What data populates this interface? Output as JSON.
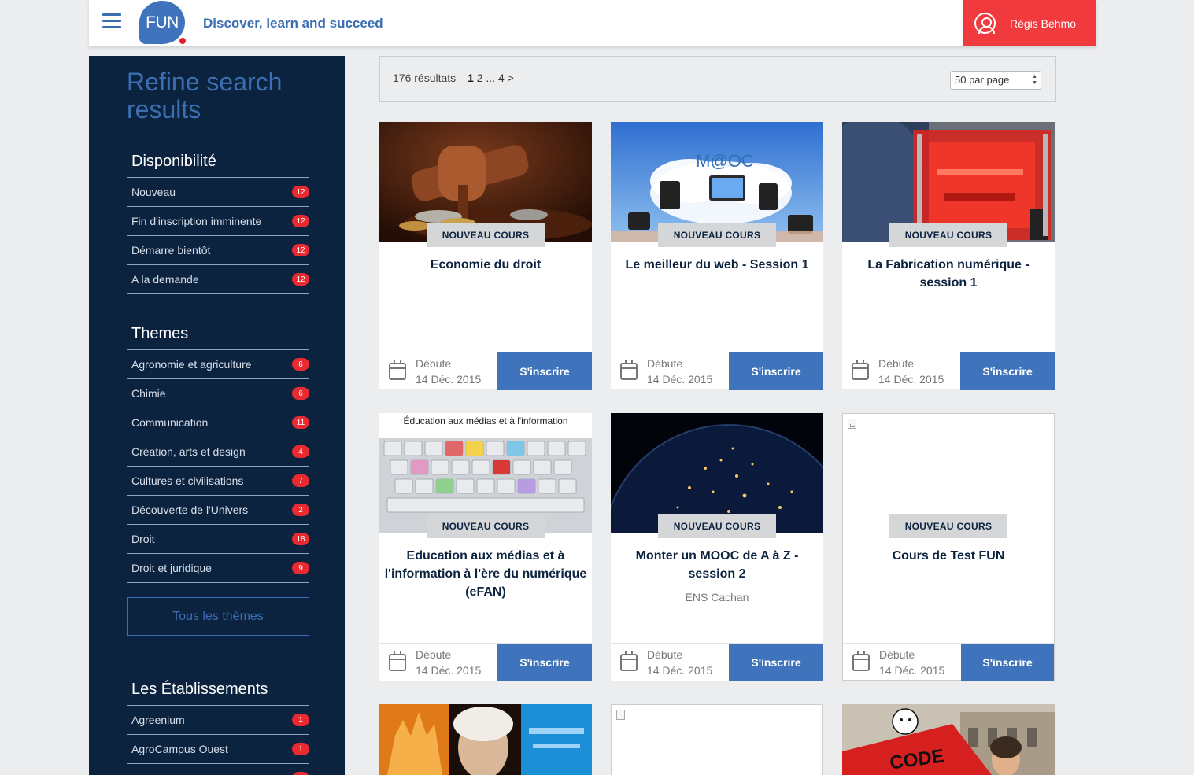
{
  "header": {
    "logo_text": "FUN",
    "tagline": "Discover, learn and succeed",
    "user_name": "Régis Behmo"
  },
  "sidebar": {
    "title": "Refine search results",
    "availability": {
      "heading": "Disponibilité",
      "items": [
        {
          "label": "Nouveau",
          "count": "12"
        },
        {
          "label": "Fin d'inscription imminente",
          "count": "12"
        },
        {
          "label": "Démarre bientôt",
          "count": "12"
        },
        {
          "label": "A la demande",
          "count": "12"
        }
      ]
    },
    "themes": {
      "heading": "Themes",
      "items": [
        {
          "label": "Agronomie et agriculture",
          "count": "6"
        },
        {
          "label": "Chimie",
          "count": "6"
        },
        {
          "label": "Communication",
          "count": "11"
        },
        {
          "label": "Création, arts et design",
          "count": "4"
        },
        {
          "label": "Cultures et civilisations",
          "count": "7"
        },
        {
          "label": "Découverte de l'Univers",
          "count": "2"
        },
        {
          "label": "Droit",
          "count": "18"
        },
        {
          "label": "Droit et juridique",
          "count": "9"
        }
      ],
      "all_button": "Tous les thèmes"
    },
    "establishments": {
      "heading": "Les Établissements",
      "items": [
        {
          "label": "Agreenium",
          "count": "1"
        },
        {
          "label": "AgroCampus Ouest",
          "count": "1"
        }
      ]
    }
  },
  "results": {
    "count_text": "176 résultats",
    "pages": {
      "current": "1",
      "next": "2",
      "ellipsis": "...",
      "last": "4",
      "arrow": ">"
    },
    "per_page": "50 par page"
  },
  "courses": [
    {
      "badge": "NOUVEAU COURS",
      "title": "Economie du droit",
      "org": "",
      "start_label": "Débute",
      "start_date": "14 Déc. 2015",
      "enroll": "S'inscrire"
    },
    {
      "badge": "NOUVEAU COURS",
      "title": "Le meilleur du web - Session 1",
      "org": "",
      "start_label": "Débute",
      "start_date": "14 Déc. 2015",
      "enroll": "S'inscrire",
      "image_text": "M@OC"
    },
    {
      "badge": "NOUVEAU COURS",
      "title": "La Fabrication numérique - session 1",
      "org": "",
      "start_label": "Débute",
      "start_date": "14 Déc. 2015",
      "enroll": "S'inscrire"
    },
    {
      "badge": "NOUVEAU COURS",
      "title": "Education aux médias et à l'information à l'ère du numérique (eFAN)",
      "org": "",
      "start_label": "Débute",
      "start_date": "14 Déc. 2015",
      "enroll": "S'inscrire",
      "image_text": "Éducation aux médias et à l'information"
    },
    {
      "badge": "NOUVEAU COURS",
      "title": "Monter un MOOC de A à Z - session 2",
      "org": "ENS Cachan",
      "start_label": "Débute",
      "start_date": "14 Déc. 2015",
      "enroll": "S'inscrire"
    },
    {
      "badge": "NOUVEAU COURS",
      "title": "Cours de Test FUN",
      "org": "",
      "start_label": "Débute",
      "start_date": "14 Déc. 2015",
      "enroll": "S'inscrire"
    }
  ],
  "partial_cards": [
    {
      "image": "cathedral-collage"
    },
    {
      "image": "broken"
    },
    {
      "image": "code-du-protest",
      "image_text": "CODE"
    }
  ],
  "colors": {
    "brand_blue": "#3f74bc",
    "navy": "#0c2340",
    "red": "#f03a3e",
    "badge_red": "#e92a30"
  }
}
